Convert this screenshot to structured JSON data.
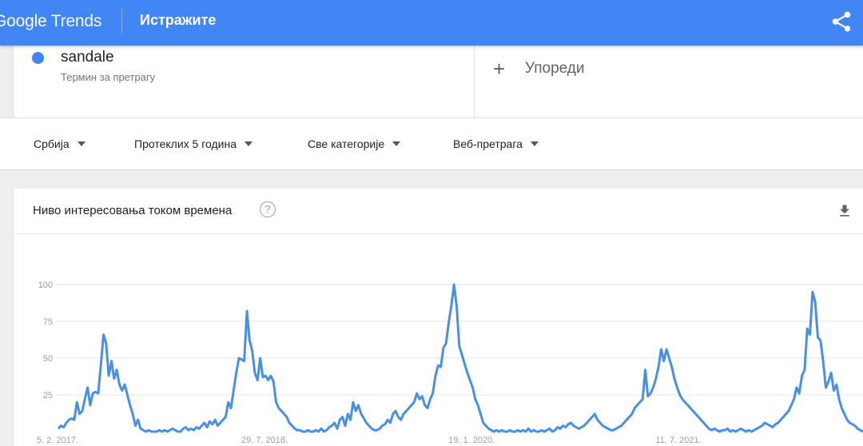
{
  "header": {
    "logo_google": "Google",
    "logo_trends": "Trends",
    "title": "Истражите",
    "share_icon": "share-icon",
    "background": "#4285f4"
  },
  "term": {
    "name": "sandale",
    "subtitle": "Термин за претрагу",
    "color": "#4285f4"
  },
  "compare": {
    "label": "Упореди",
    "icon": "plus-icon"
  },
  "filters": [
    {
      "label": "Србија"
    },
    {
      "label": "Протеклих 5 година"
    },
    {
      "label": "Све категорије"
    },
    {
      "label": "Веб-претрага"
    }
  ],
  "chart_card": {
    "title": "Ниво интересовања током времена",
    "help_icon": "help-icon",
    "download_icon": "download-icon"
  },
  "chart_data": {
    "type": "line",
    "title": "Ниво интересовања током времена",
    "xlabel": "",
    "ylabel": "",
    "ylim": [
      0,
      100
    ],
    "yticks": [
      100,
      75,
      50,
      25
    ],
    "x_tick_labels": [
      "5. 2. 2017.",
      "29. 7. 2018.",
      "19. 1. 2020.",
      "11. 7. 2021."
    ],
    "grid": true,
    "series": [
      {
        "color": "#4a90e2",
        "values": [
          2,
          4,
          3,
          6,
          8,
          9,
          8,
          20,
          12,
          14,
          22,
          30,
          18,
          26,
          27,
          26,
          45,
          66,
          60,
          38,
          48,
          36,
          42,
          32,
          28,
          32,
          25,
          18,
          12,
          4,
          8,
          2,
          1,
          0,
          1,
          0,
          0,
          0,
          1,
          0,
          1,
          0,
          1,
          2,
          1,
          0,
          0,
          2,
          3,
          1,
          2,
          1,
          3,
          2,
          4,
          6,
          3,
          7,
          5,
          8,
          4,
          6,
          8,
          10,
          20,
          16,
          28,
          40,
          50,
          49,
          48,
          82,
          62,
          55,
          40,
          35,
          50,
          37,
          38,
          35,
          38,
          34,
          20,
          16,
          14,
          12,
          10,
          6,
          4,
          2,
          1,
          1,
          0,
          0,
          1,
          0,
          0,
          1,
          0,
          2,
          0,
          1,
          3,
          4,
          6,
          2,
          8,
          10,
          4,
          12,
          8,
          20,
          14,
          18,
          12,
          9,
          6,
          4,
          2,
          1,
          1,
          2,
          4,
          5,
          8,
          6,
          12,
          14,
          10,
          8,
          12,
          14,
          16,
          18,
          20,
          26,
          22,
          24,
          18,
          16,
          22,
          26,
          38,
          45,
          44,
          57,
          60,
          74,
          86,
          100,
          85,
          58,
          52,
          46,
          40,
          35,
          30,
          22,
          18,
          12,
          6,
          4,
          2,
          1,
          0,
          1,
          0,
          1,
          0,
          0,
          1,
          0,
          0,
          1,
          0,
          1,
          0,
          2,
          0,
          1,
          0,
          0,
          1,
          0,
          1,
          2,
          0,
          1,
          3,
          2,
          4,
          3,
          5,
          6,
          4,
          3,
          2,
          3,
          4,
          6,
          8,
          10,
          12,
          8,
          6,
          4,
          3,
          2,
          1,
          1,
          2,
          3,
          4,
          6,
          8,
          10,
          12,
          16,
          18,
          20,
          22,
          42,
          24,
          26,
          30,
          36,
          44,
          56,
          48,
          56,
          50,
          44,
          36,
          30,
          25,
          22,
          20,
          18,
          16,
          14,
          12,
          10,
          8,
          6,
          4,
          2,
          1,
          2,
          1,
          0,
          1,
          1,
          2,
          0,
          1,
          0,
          1,
          2,
          1,
          0,
          1,
          0,
          1,
          2,
          3,
          4,
          6,
          5,
          4,
          3,
          5,
          6,
          8,
          10,
          12,
          14,
          18,
          22,
          30,
          26,
          38,
          42,
          70,
          66,
          95,
          88,
          64,
          62,
          48,
          30,
          34,
          40,
          28,
          32,
          22,
          16,
          12,
          8,
          6,
          5,
          4,
          2,
          1,
          0
        ]
      }
    ]
  }
}
